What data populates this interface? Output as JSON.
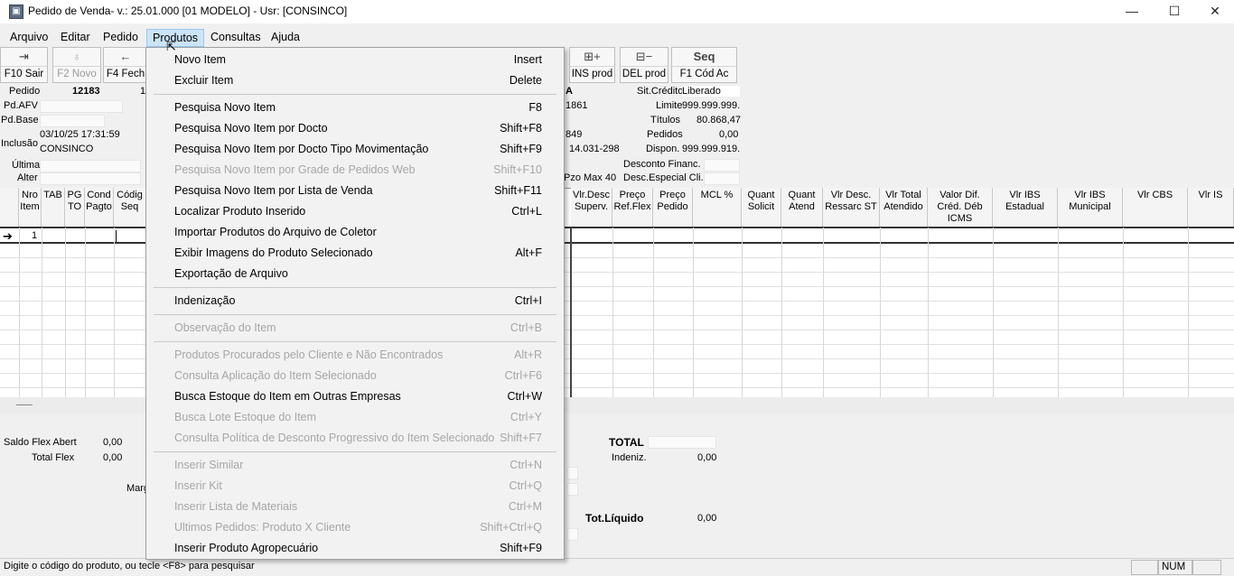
{
  "window": {
    "title": "Pedido de Venda- v.: 25.01.000  [01 MODELO] - Usr: [CONSINCO]",
    "app_icon": "app-icon",
    "controls": [
      "—",
      "☐",
      "✕"
    ]
  },
  "menubar": {
    "items": [
      "Arquivo",
      "Editar",
      "Pedido",
      "Produtos",
      "Consultas",
      "Ajuda"
    ],
    "active": "Produtos"
  },
  "toolbar": {
    "left": [
      {
        "label": "F10 Sair",
        "icon": "exit-icon",
        "disabled": false
      },
      {
        "label": "F2 Novo",
        "icon": "lightbulb-icon",
        "disabled": true
      },
      {
        "label": "F4 Fech",
        "icon": "back-arrow-icon",
        "disabled": false
      }
    ],
    "right": [
      {
        "label": "INS prod",
        "icon": "insert-product-icon",
        "glyph": "⊞+"
      },
      {
        "label": "DEL prod",
        "icon": "delete-product-icon",
        "glyph": "⊟−"
      },
      {
        "label": "F1 Cód Ac",
        "top": "Seq"
      }
    ]
  },
  "header_left": {
    "pedido_label": "Pedido",
    "pedido_value": "12183",
    "pedido_extra": "1",
    "pdafv_label": "Pd.AFV",
    "pdbase_label": "Pd.Base",
    "inclusao_label": "Inclusão",
    "inclusao_date": "03/10/25 17:31:59",
    "inclusao_user": "CONSINCO",
    "ultima_label": "Última",
    "alter_label": "Alter"
  },
  "header_mid": {
    "a": "A",
    "code1": "1861",
    "code2": "849",
    "code3": "14.031-298",
    "pzo": "Pzo Max 40"
  },
  "header_right": {
    "sit_credito_label": "Sit.Crédito",
    "sit_credito_value": "Liberado",
    "limite_label": "Limite",
    "limite_value": "999.999.999.",
    "titulos_label": "Títulos",
    "titulos_value": "80.868,47",
    "pedidos_label": "Pedidos",
    "pedidos_value": "0,00",
    "dispon_label": "Dispon.",
    "dispon_value": "999.999.919.",
    "desconto_label": "Desconto Financ.",
    "desc_especial_label": "Desc.Especial Cli."
  },
  "grid": {
    "left_columns": [
      "Nro Item",
      "TAB",
      "PG TO",
      "Cond Pagto",
      "Códig Seq"
    ],
    "right_columns": [
      "Vlr.Desc Superv.",
      "Preço Ref.Flex",
      "Preço Pedido",
      "MCL %",
      "Quant Solicit",
      "Quant Atend",
      "Vlr Desc. Ressarc ST",
      "Vlr Total Atendido",
      "Valor Dif. Créd. Déb ICMS",
      "Vlr IBS Estadual",
      "Vlr IBS Municipal",
      "Vlr CBS",
      "Vlr IS"
    ],
    "first_row_arrow": "➔",
    "first_row_item": "1"
  },
  "summary": {
    "saldo_flex_label": "Saldo Flex Abert",
    "saldo_flex_value": "0,00",
    "total_flex_label": "Total Flex",
    "total_flex_value": "0,00",
    "marg_label": "Marg",
    "total_label": "TOTAL",
    "indeniz_label": "Indeniz.",
    "indeniz_value": "0,00",
    "tot_liquido_label": "Tot.Líquido",
    "tot_liquido_value": "0,00"
  },
  "status": {
    "text": "Digite o código do produto, ou tecle <F8> para pesquisar",
    "num": "NUM"
  },
  "dropdown": {
    "items": [
      {
        "label": "Novo Item",
        "shortcut": "Insert",
        "disabled": false
      },
      {
        "label": "Excluir Item",
        "shortcut": "Delete",
        "disabled": false
      },
      {
        "sep": true
      },
      {
        "label": "Pesquisa Novo Item",
        "shortcut": "F8",
        "disabled": false
      },
      {
        "label": "Pesquisa Novo Item por Docto",
        "shortcut": "Shift+F8",
        "disabled": false
      },
      {
        "label": "Pesquisa Novo Item por Docto Tipo Movimentação",
        "shortcut": "Shift+F9",
        "disabled": false
      },
      {
        "label": "Pesquisa Novo Item por Grade de Pedidos Web",
        "shortcut": "Shift+F10",
        "disabled": true
      },
      {
        "label": "Pesquisa Novo Item por Lista de Venda",
        "shortcut": "Shift+F11",
        "disabled": false
      },
      {
        "label": "Localizar Produto Inserido",
        "shortcut": "Ctrl+L",
        "disabled": false
      },
      {
        "label": "Importar Produtos do Arquivo de Coletor",
        "shortcut": "",
        "disabled": false
      },
      {
        "label": "Exibir Imagens do Produto Selecionado",
        "shortcut": "Alt+F",
        "disabled": false
      },
      {
        "label": "Exportação de Arquivo",
        "shortcut": "",
        "disabled": false
      },
      {
        "sep": true
      },
      {
        "label": "Indenização",
        "shortcut": "Ctrl+I",
        "disabled": false
      },
      {
        "sep": true
      },
      {
        "label": "Observação do Item",
        "shortcut": "Ctrl+B",
        "disabled": true
      },
      {
        "sep": true
      },
      {
        "label": "Produtos Procurados pelo Cliente e Não Encontrados",
        "shortcut": "Alt+R",
        "disabled": true
      },
      {
        "label": "Consulta Aplicação do Item Selecionado",
        "shortcut": "Ctrl+F6",
        "disabled": true
      },
      {
        "label": "Busca Estoque do Item em Outras Empresas",
        "shortcut": "Ctrl+W",
        "disabled": false
      },
      {
        "label": "Busca Lote Estoque do Item",
        "shortcut": "Ctrl+Y",
        "disabled": true
      },
      {
        "label": "Consulta Política de Desconto Progressivo do Item Selecionado",
        "shortcut": "Shift+F7",
        "disabled": true
      },
      {
        "sep": true
      },
      {
        "label": "Inserir Similar",
        "shortcut": "Ctrl+N",
        "disabled": true
      },
      {
        "label": "Inserir Kit",
        "shortcut": "Ctrl+Q",
        "disabled": true
      },
      {
        "label": "Inserir Lista de Materiais",
        "shortcut": "Ctrl+M",
        "disabled": true
      },
      {
        "label": "Ultimos Pedidos: Produto X Cliente",
        "shortcut": "Shift+Ctrl+Q",
        "disabled": true
      },
      {
        "label": "Inserir Produto Agropecuário",
        "shortcut": "Shift+F9",
        "disabled": false
      }
    ]
  }
}
